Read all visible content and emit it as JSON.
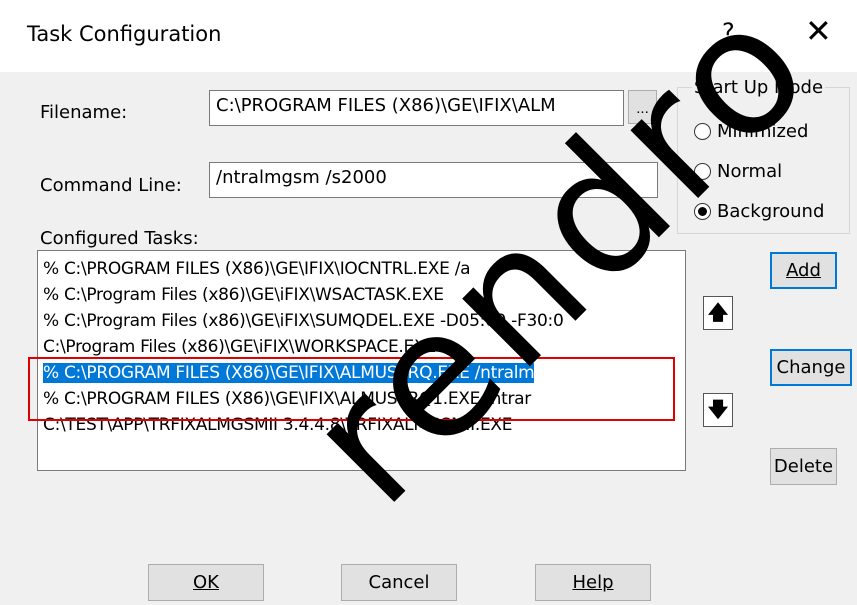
{
  "window": {
    "title": "Task Configuration",
    "help_label": "?",
    "close_label": "✕"
  },
  "filename": {
    "label": "Filename:",
    "value": "C:\\PROGRAM FILES (X86)\\GE\\IFIX\\ALM",
    "browse_label": "..."
  },
  "command_line": {
    "label": "Command Line:",
    "value": "/ntralmgsm /s2000"
  },
  "startup_mode": {
    "title": "Start Up Mode",
    "options": [
      {
        "label": "Minimized",
        "selected": false
      },
      {
        "label": "Normal",
        "selected": false
      },
      {
        "label": "Background",
        "selected": true
      }
    ]
  },
  "configured_tasks": {
    "label": "Configured Tasks:",
    "items": [
      {
        "text": "% C:\\PROGRAM FILES (X86)\\GE\\IFIX\\IOCNTRL.EXE  /a",
        "selected": false
      },
      {
        "text": "% C:\\Program Files (x86)\\GE\\iFIX\\WSACTASK.EXE",
        "selected": false
      },
      {
        "text": "% C:\\Program Files (x86)\\GE\\iFIX\\SUMQDEL.EXE  -D05:00 -F30:0",
        "selected": false
      },
      {
        "text": "  C:\\Program Files (x86)\\GE\\iFIX\\WORKSPACE.EXE",
        "selected": false
      },
      {
        "text": "% C:\\PROGRAM FILES (X86)\\GE\\IFIX\\ALMUSERQ.EXE  /ntralm",
        "selected": true
      },
      {
        "text": "% C:\\PROGRAM FILES (X86)\\GE\\IFIX\\ALMUSERQ1.EXE  /ntrar",
        "selected": false
      },
      {
        "text": "  C:\\TEST\\APP\\TRFIXALMGSMII 3.4.4.8\\TRFIXALMGSMII.EXE",
        "selected": false
      }
    ]
  },
  "buttons": {
    "add": "Add",
    "change": "Change",
    "delete": "Delete",
    "move_up_icon": "up-arrow",
    "move_down_icon": "down-arrow",
    "ok": "OK",
    "cancel": "Cancel",
    "help": "Help"
  },
  "watermark": "rendro"
}
